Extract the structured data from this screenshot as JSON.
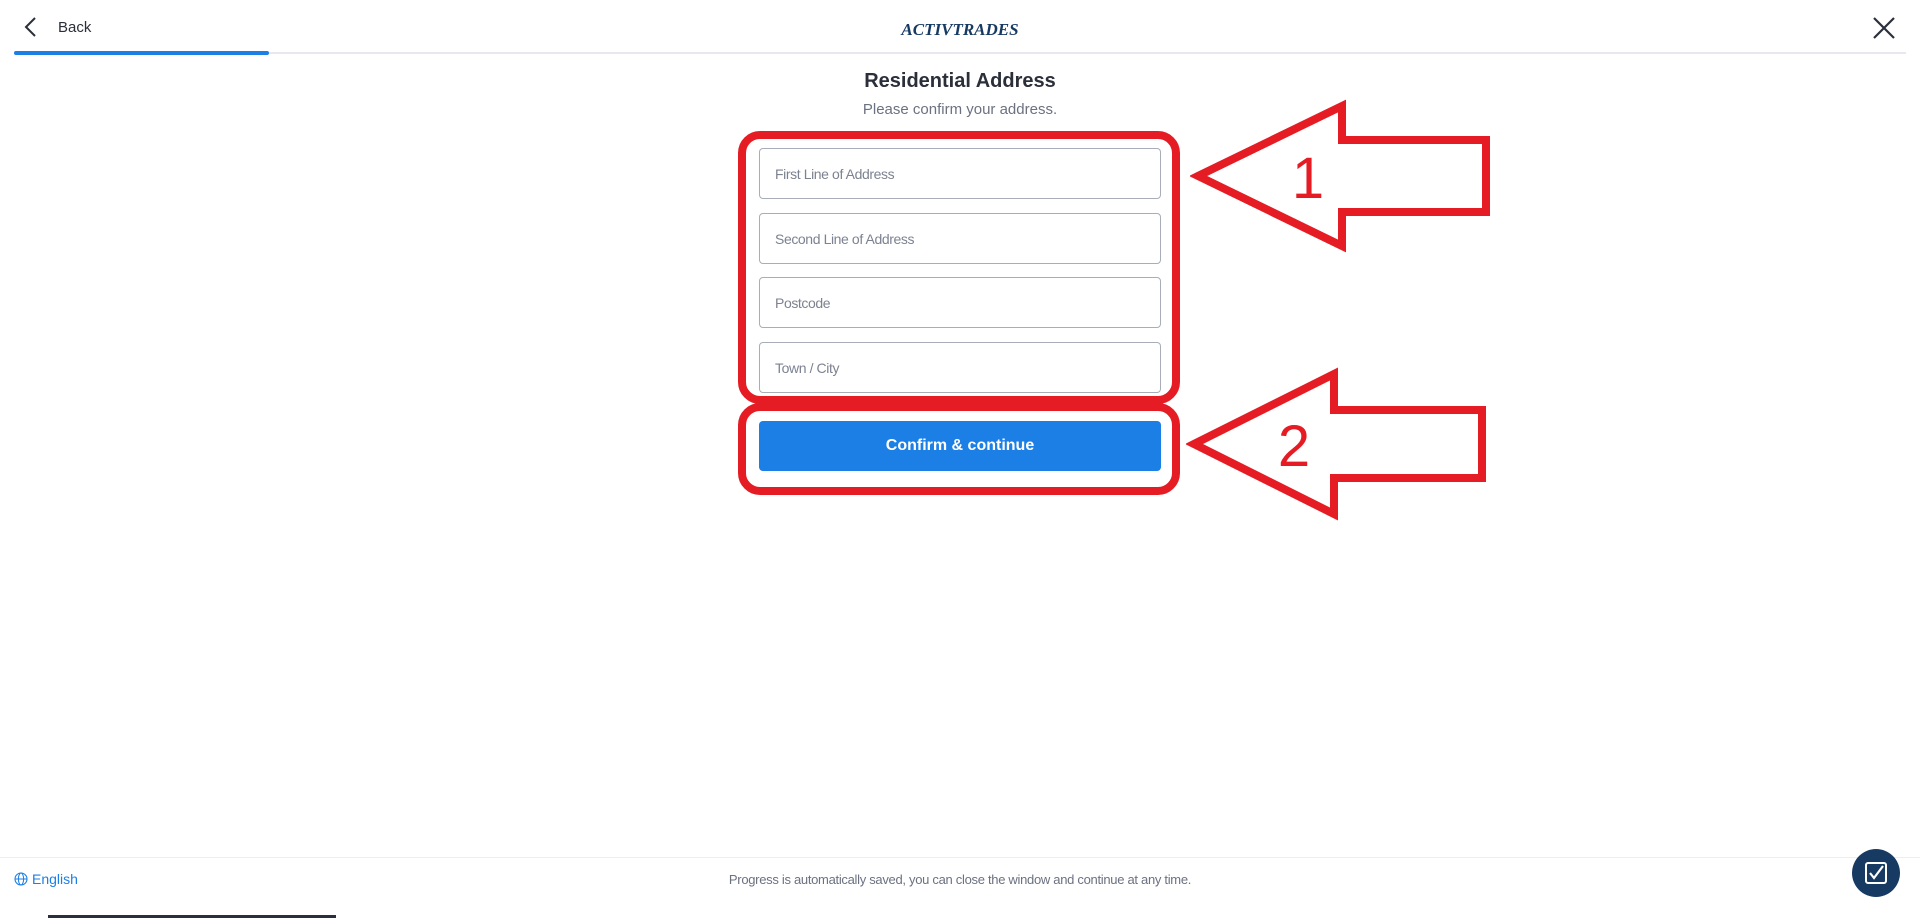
{
  "header": {
    "back_label": "Back",
    "logo_text": "ACTIVTRADES",
    "progress_percent": 13.5
  },
  "form": {
    "title": "Residential Address",
    "subtitle": "Please confirm your address.",
    "fields": [
      {
        "placeholder": "First Line of Address",
        "value": ""
      },
      {
        "placeholder": "Second Line of Address",
        "value": ""
      },
      {
        "placeholder": "Postcode",
        "value": ""
      },
      {
        "placeholder": "Town / City",
        "value": ""
      }
    ],
    "confirm_label": "Confirm & continue"
  },
  "annotations": [
    {
      "label": "1"
    },
    {
      "label": "2"
    }
  ],
  "footer": {
    "language_label": "English",
    "note": "Progress is automatically saved, you can close the window and continue at any time."
  },
  "colors": {
    "accent": "#1b7fe6",
    "annotation": "#e51c23",
    "logo": "#173a63",
    "text": "#2b2f3a",
    "muted": "#6b7180"
  }
}
